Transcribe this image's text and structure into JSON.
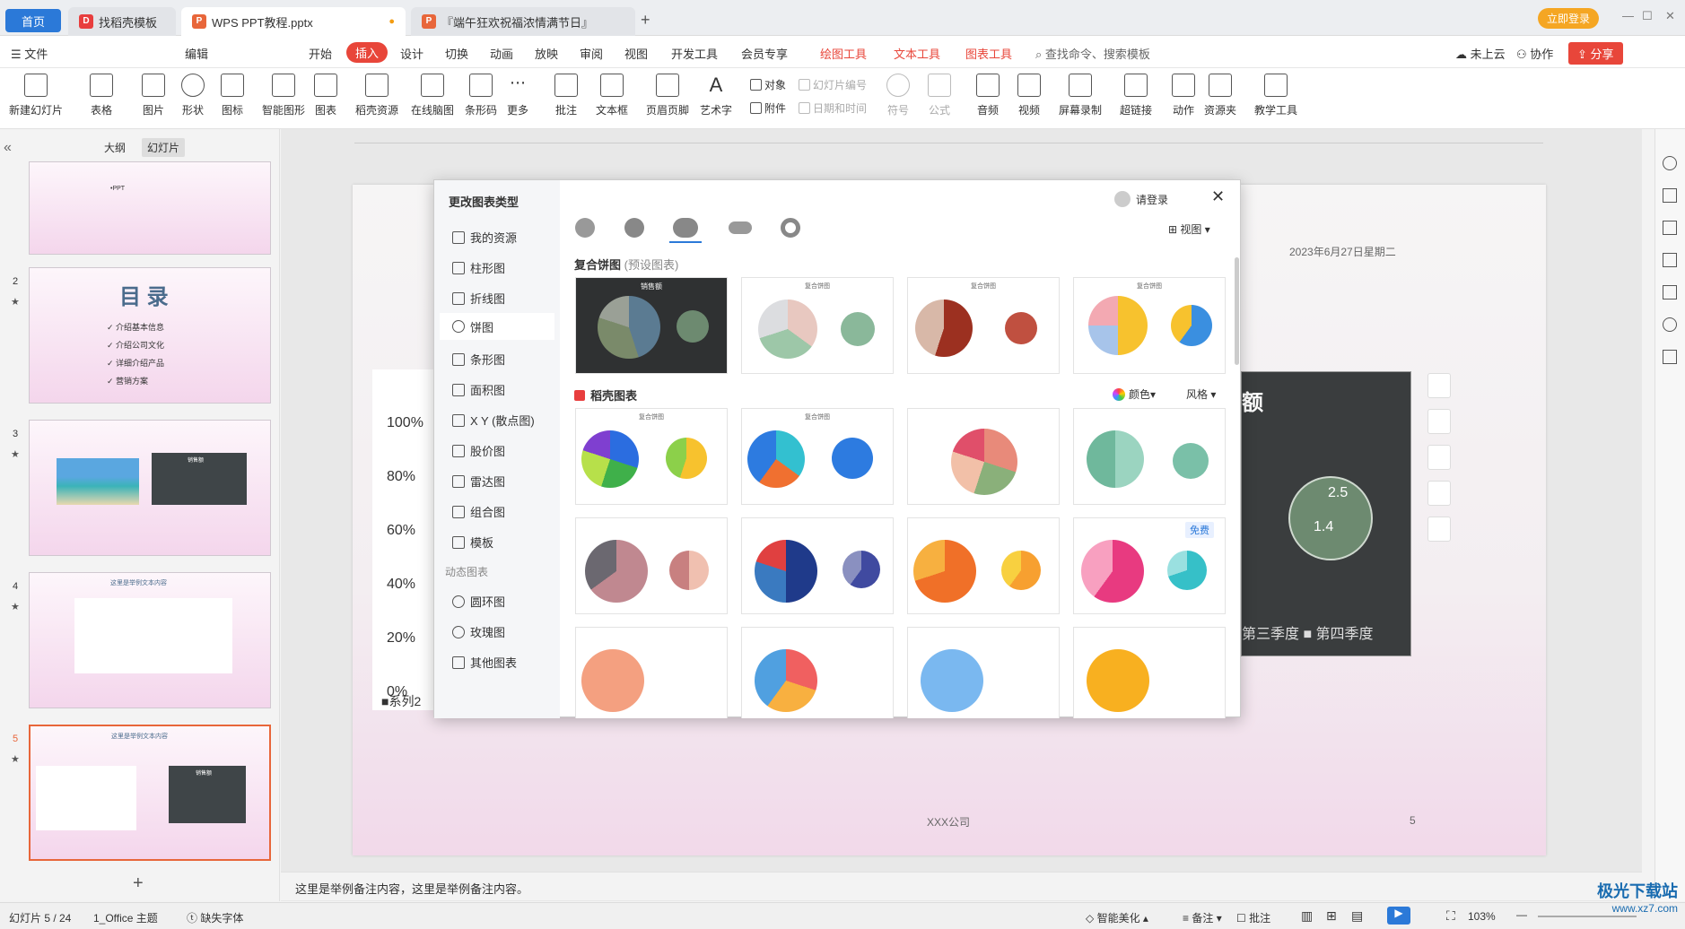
{
  "tabs": {
    "home": "首页",
    "t1": "找稻壳模板",
    "t2": "WPS PPT教程.pptx",
    "t3": "『端午狂欢祝福浓情满节日』"
  },
  "titlebar": {
    "login": "立即登录"
  },
  "menu": {
    "file": "文件",
    "edit": "编辑",
    "start": "开始",
    "insert": "插入",
    "design": "设计",
    "switch": "切换",
    "anim": "动画",
    "show": "放映",
    "review": "审阅",
    "view": "视图",
    "dev": "开发工具",
    "vip": "会员专享",
    "draw": "绘图工具",
    "text": "文本工具",
    "chart": "图表工具",
    "search": "查找命令、搜索模板",
    "cloud": "未上云",
    "coop": "协作",
    "share": "分享"
  },
  "toolbar": {
    "new_slide": "新建幻灯片",
    "table": "表格",
    "picture": "图片",
    "shape": "形状",
    "icon": "图标",
    "smart": "智能图形",
    "chart": "图表",
    "daoke": "稻壳资源",
    "mind": "在线脑图",
    "barcode": "条形码",
    "more": "更多",
    "comment": "批注",
    "textbox": "文本框",
    "header": "页眉页脚",
    "art": "艺术字",
    "object": "对象",
    "attach": "附件",
    "slidenum": "幻灯片编号",
    "datetime": "日期和时间",
    "symbol": "符号",
    "formula": "公式",
    "audio": "音频",
    "video": "视频",
    "record": "屏幕录制",
    "link": "超链接",
    "action": "动作",
    "resource": "资源夹",
    "teach": "教学工具"
  },
  "leftpanel": {
    "outline": "大纲",
    "slides": "幻灯片",
    "s1_text": "•PPT",
    "s2_title": "目 录",
    "s2_items": [
      "介绍基本信息",
      "介绍公司文化",
      "详细介绍产品",
      "营销方案"
    ],
    "s3_chart_title": "销售额",
    "s4_title": "这里是举例文本内容",
    "s5_title": "这里是举例文本内容",
    "s5_chart_title": "销售额",
    "nums": [
      "2",
      "3",
      "4",
      "5"
    ]
  },
  "slide": {
    "date": "2023年6月27日星期二",
    "company": "XXX公司",
    "page": "5",
    "y_ticks": [
      "100%",
      "80%",
      "60%",
      "40%",
      "20%",
      "0%"
    ],
    "series_label": "系列2",
    "chart_title": "额",
    "v1": "2.5",
    "v2": "1.4",
    "legend": "第三季度 ■ 第四季度"
  },
  "dialog": {
    "title": "更改图表类型",
    "login": "请登录",
    "view": "视图",
    "categories": [
      "我的资源",
      "柱形图",
      "折线图",
      "饼图",
      "条形图",
      "面积图",
      "X Y (散点图)",
      "股价图",
      "雷达图",
      "组合图",
      "模板"
    ],
    "dyn_title": "动态图表",
    "dyn": [
      "圆环图",
      "玫瑰图",
      "其他图表"
    ],
    "section1": "复合饼图",
    "section1_sub": "(预设图表)",
    "section2": "稻壳图表",
    "color": "颜色",
    "style": "风格",
    "card_dark": "销售额",
    "card_t": "复合饼图",
    "free": "免费"
  },
  "notes": {
    "text": "这里是举例备注内容，这里是举例备注内容。"
  },
  "status": {
    "slide": "幻灯片 5 / 24",
    "theme": "1_Office 主题",
    "font": "缺失字体",
    "beautify": "智能美化",
    "notes": "备注",
    "comment": "批注",
    "zoom": "103%"
  },
  "watermark": {
    "name": "极光下载站",
    "url": "www.xz7.com"
  }
}
